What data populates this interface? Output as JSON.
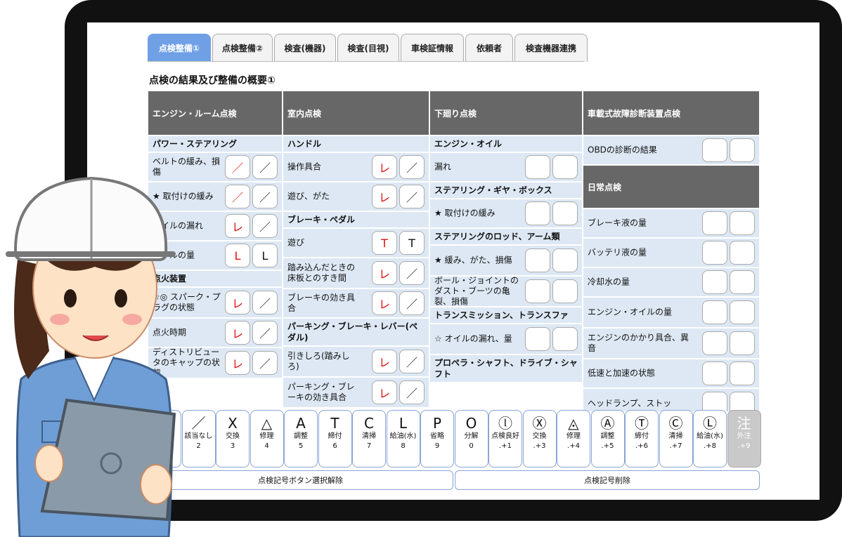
{
  "tabs": [
    "点検整備①",
    "点検整備②",
    "検査(機器)",
    "検査(目視)",
    "車検証情報",
    "依頼者",
    "検査機器連携"
  ],
  "page_title": "点検の結果及び整備の概要①",
  "columns": [
    {
      "header": "エンジン・ルーム点検",
      "entries": [
        {
          "type": "section",
          "label": "パワー・ステアリング"
        },
        {
          "type": "row",
          "label": "ベルトの緩み、損傷",
          "marks": [
            "／",
            "／"
          ]
        },
        {
          "type": "row",
          "label": "★ 取付けの緩み",
          "marks": [
            "／",
            "／"
          ]
        },
        {
          "type": "row",
          "label": "オイルの漏れ",
          "marks": [
            "レ",
            "／"
          ]
        },
        {
          "type": "row",
          "label": "オイルの量",
          "marks": [
            "L",
            "L"
          ]
        },
        {
          "type": "section",
          "label": "点火装置"
        },
        {
          "type": "row",
          "label": "☆◎ スパーク・プラグの状態",
          "marks": [
            "レ",
            "／"
          ]
        },
        {
          "type": "row",
          "label": "点火時期",
          "marks": [
            "レ",
            "／"
          ]
        },
        {
          "type": "row",
          "label": "ディストリビュータのキャップの状態",
          "marks": [
            "レ",
            "／"
          ]
        }
      ]
    },
    {
      "header": "室内点検",
      "entries": [
        {
          "type": "section",
          "label": "ハンドル"
        },
        {
          "type": "row",
          "label": "操作具合",
          "marks": [
            "レ",
            "／"
          ]
        },
        {
          "type": "row",
          "label": "遊び、がた",
          "marks": [
            "レ",
            "／"
          ]
        },
        {
          "type": "section",
          "label": "ブレーキ・ペダル"
        },
        {
          "type": "row",
          "label": "遊び",
          "marks": [
            "T",
            "T"
          ]
        },
        {
          "type": "row",
          "label": "踏み込んだときの床板とのすき間",
          "marks": [
            "レ",
            "／"
          ]
        },
        {
          "type": "row",
          "label": "ブレーキの効き具合",
          "marks": [
            "レ",
            "／"
          ]
        },
        {
          "type": "section",
          "label": "パーキング・ブレーキ・レバー(ペダル)"
        },
        {
          "type": "row",
          "label": "引きしろ(踏みしろ)",
          "marks": [
            "レ",
            "／"
          ]
        },
        {
          "type": "row",
          "label": "パーキング・ブレーキの効き具合",
          "marks": [
            "レ",
            "／"
          ]
        }
      ]
    },
    {
      "header": "下廻り点検",
      "entries": [
        {
          "type": "section",
          "label": "エンジン・オイル"
        },
        {
          "type": "row",
          "label": "漏れ",
          "marks": [
            "",
            ""
          ]
        },
        {
          "type": "section",
          "label": "ステアリング・ギヤ・ボックス"
        },
        {
          "type": "row",
          "label": "★ 取付けの緩み",
          "marks": [
            "",
            ""
          ]
        },
        {
          "type": "section",
          "label": "ステアリングのロッド、アーム類"
        },
        {
          "type": "row",
          "label": "★ 緩み、がた、損傷",
          "marks": [
            "",
            ""
          ]
        },
        {
          "type": "row",
          "label": "ボール・ジョイントのダスト・ブーツの亀裂、損傷",
          "marks": [
            "",
            ""
          ]
        },
        {
          "type": "section",
          "label": "トランスミッション、トランスファ"
        },
        {
          "type": "row",
          "label": "☆ オイルの漏れ、量",
          "marks": [
            "",
            ""
          ]
        },
        {
          "type": "section",
          "label": "プロペラ・シャフト、ドライブ・シャフト"
        }
      ]
    },
    {
      "header": "車載式故障診断装置点検",
      "entries": [
        {
          "type": "row",
          "label": "OBDの診断の結果",
          "marks": [
            "",
            ""
          ]
        },
        {
          "type": "header",
          "label": "日常点検"
        },
        {
          "type": "row",
          "label": "ブレーキ液の量",
          "marks": [
            "",
            ""
          ]
        },
        {
          "type": "row",
          "label": "バッテリ液の量",
          "marks": [
            "",
            ""
          ]
        },
        {
          "type": "row",
          "label": "冷却水の量",
          "marks": [
            "",
            ""
          ]
        },
        {
          "type": "row",
          "label": "エンジン・オイルの量",
          "marks": [
            "",
            ""
          ]
        },
        {
          "type": "row",
          "label": "エンジンのかかり具合、異音",
          "marks": [
            "",
            ""
          ]
        },
        {
          "type": "row",
          "label": "低速と加速の状態",
          "marks": [
            "",
            ""
          ]
        },
        {
          "type": "row",
          "label": "ヘッドランプ、ストッ",
          "marks": [
            "",
            ""
          ]
        }
      ]
    }
  ],
  "symbols": [
    {
      "glyph": "レ",
      "label": "良好",
      "key": "1"
    },
    {
      "glyph": "／",
      "label": "該当なし",
      "key": "2"
    },
    {
      "glyph": "X",
      "label": "交換",
      "key": "3"
    },
    {
      "glyph": "△",
      "label": "修理",
      "key": "4"
    },
    {
      "glyph": "A",
      "label": "調整",
      "key": "5"
    },
    {
      "glyph": "T",
      "label": "締付",
      "key": "6"
    },
    {
      "glyph": "C",
      "label": "清掃",
      "key": "7"
    },
    {
      "glyph": "L",
      "label": "給油(水)",
      "key": "8"
    },
    {
      "glyph": "P",
      "label": "省略",
      "key": "9"
    },
    {
      "glyph": "O",
      "label": "分解",
      "key": "0"
    },
    {
      "glyph": "ⓛ",
      "label": "点検良好",
      "key": ".+1"
    },
    {
      "glyph": "Ⓧ",
      "label": "交換",
      "key": ".+3"
    },
    {
      "glyph": "◬",
      "label": "修理",
      "key": ".+4"
    },
    {
      "glyph": "Ⓐ",
      "label": "調整",
      "key": ".+5"
    },
    {
      "glyph": "Ⓣ",
      "label": "締付",
      "key": ".+6"
    },
    {
      "glyph": "Ⓒ",
      "label": "清掃",
      "key": ".+7"
    },
    {
      "glyph": "Ⓛ",
      "label": "給油(水)",
      "key": ".+8"
    },
    {
      "glyph": "注",
      "label": "外注",
      "key": ".+9"
    }
  ],
  "bottom_buttons": [
    "点検記号ボタン選択解除",
    "点検記号削除"
  ]
}
